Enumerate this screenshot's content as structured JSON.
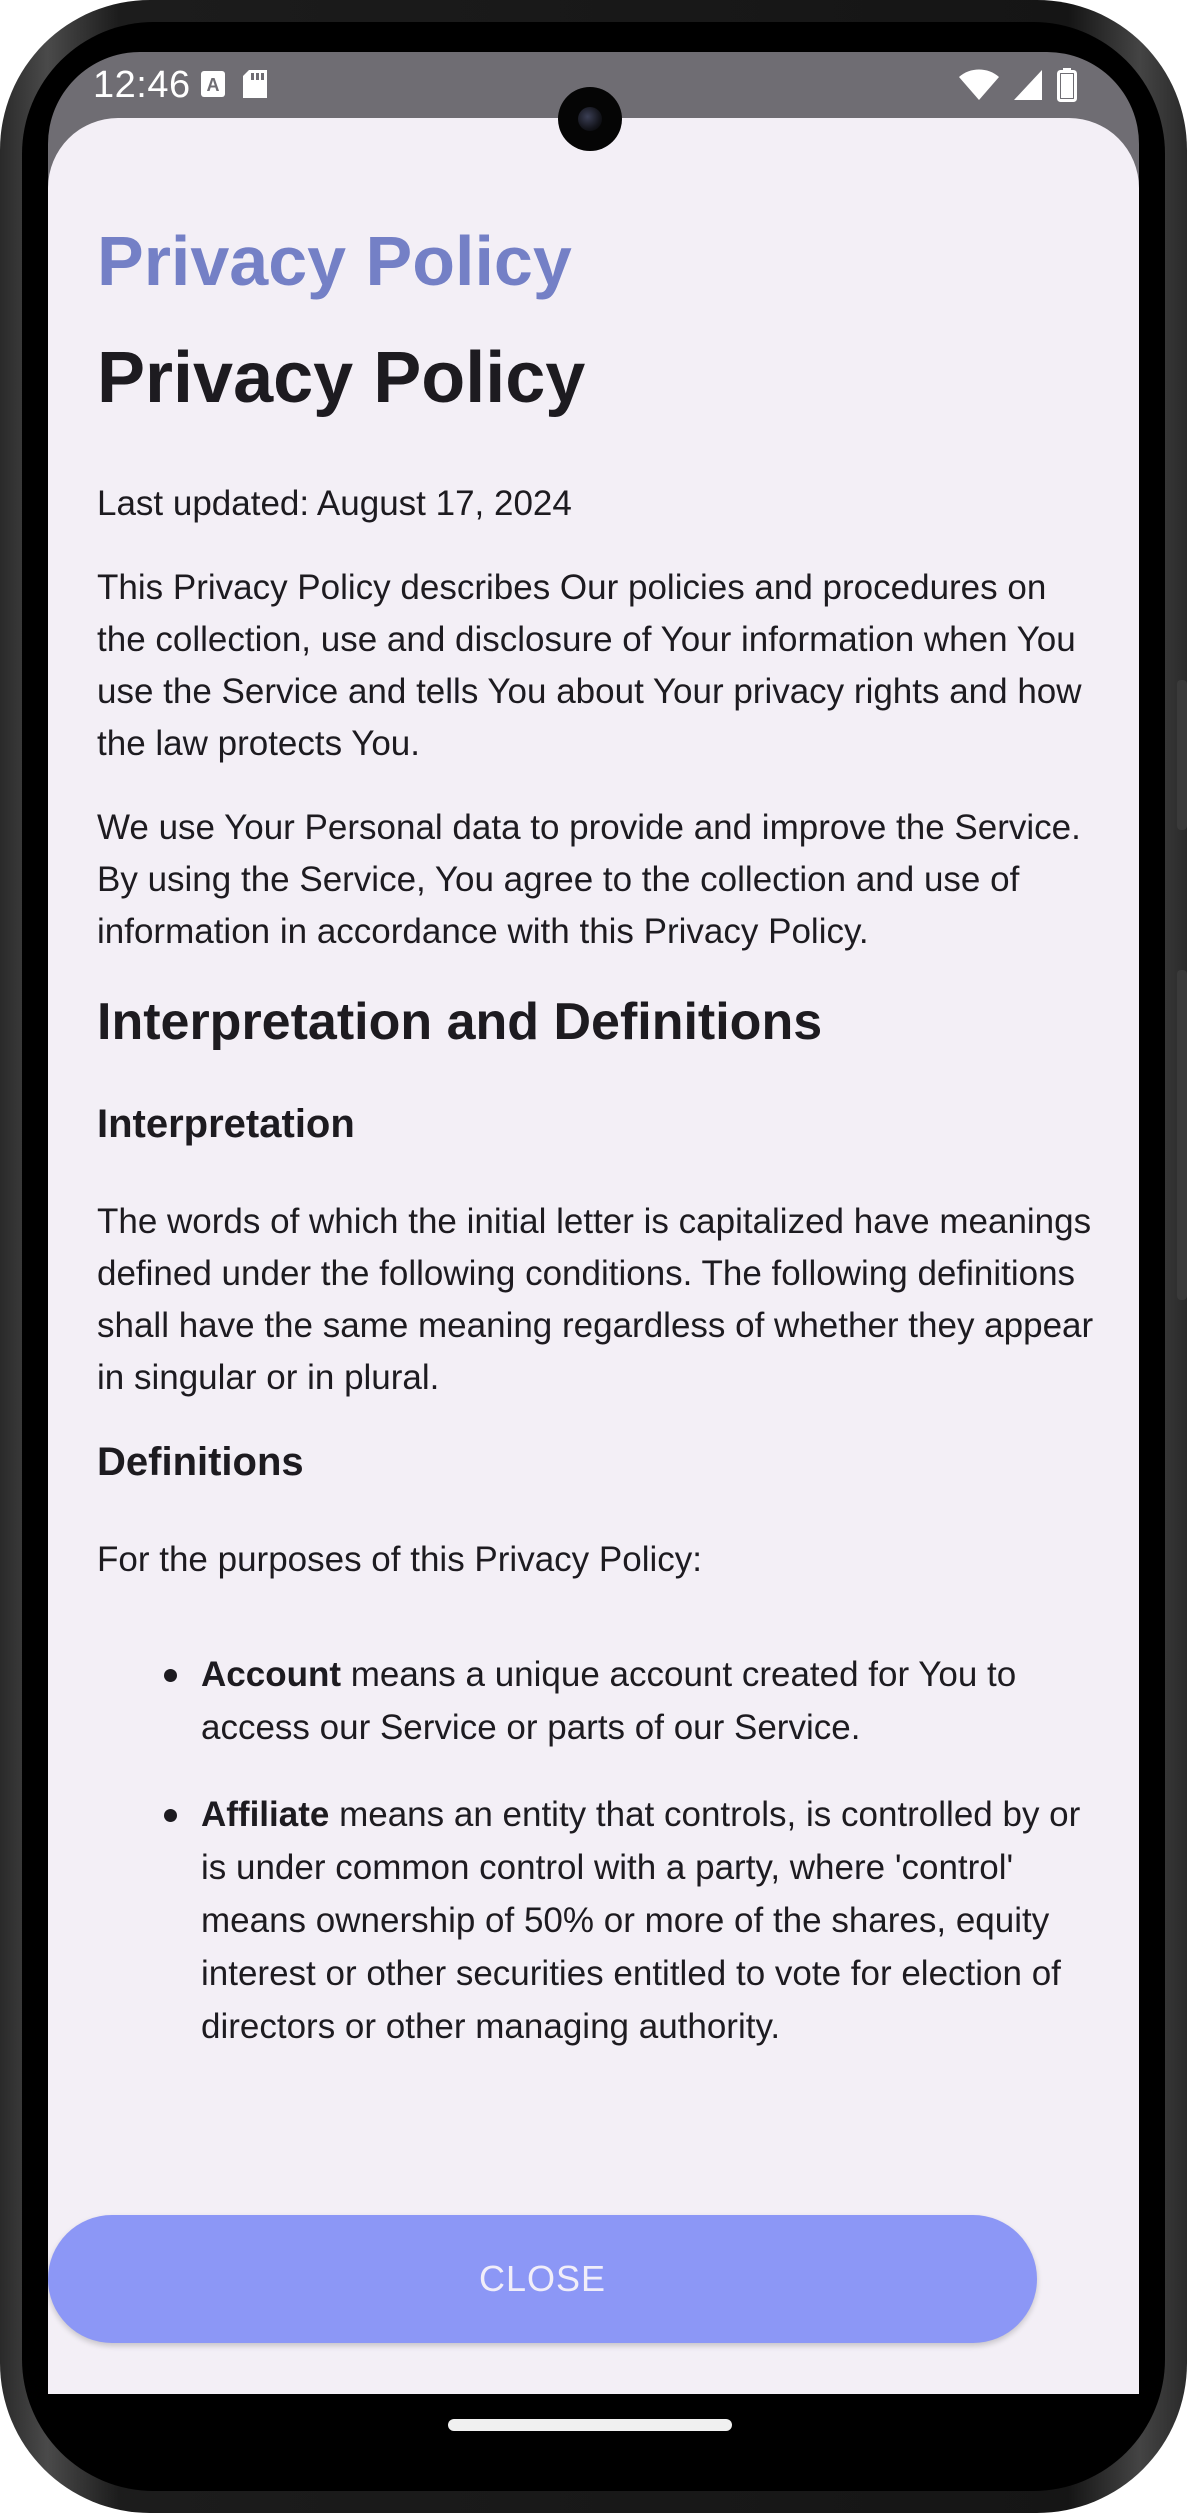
{
  "status_bar": {
    "time": "12:46"
  },
  "dialog": {
    "title": "Privacy Policy",
    "close_label": "CLOSE"
  },
  "policy": {
    "heading": "Privacy Policy",
    "last_updated": "Last updated: August 17, 2024",
    "intro_1": "This Privacy Policy describes Our policies and procedures on the collection, use and disclosure of Your information when You use the Service and tells You about Your privacy rights and how the law protects You.",
    "intro_2": "We use Your Personal data to provide and improve the Service. By using the Service, You agree to the collection and use of information in accordance with this Privacy Policy.",
    "section_interpretation_definitions": "Interpretation and Definitions",
    "interpretation_heading": "Interpretation",
    "interpretation_text": "The words of which the initial letter is capitalized have meanings defined under the following conditions. The following definitions shall have the same meaning regardless of whether they appear in singular or in plural.",
    "definitions_heading": "Definitions",
    "definitions_intro": "For the purposes of this Privacy Policy:",
    "definitions": [
      {
        "term": "Account",
        "text": " means a unique account created for You to access our Service or parts of our Service."
      },
      {
        "term": "Affiliate",
        "text": " means an entity that controls, is controlled by or is under common control with a party, where 'control' means ownership of 50% or more of the shares, equity interest or other securities entitled to vote for election of directors or other managing authority."
      }
    ]
  }
}
